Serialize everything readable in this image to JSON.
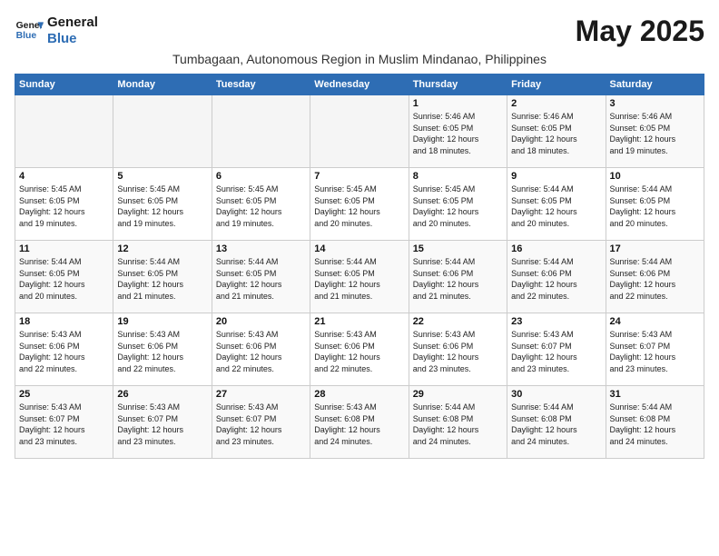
{
  "logo": {
    "line1": "General",
    "line2": "Blue"
  },
  "title": "May 2025",
  "subtitle": "Tumbagaan, Autonomous Region in Muslim Mindanao, Philippines",
  "headers": [
    "Sunday",
    "Monday",
    "Tuesday",
    "Wednesday",
    "Thursday",
    "Friday",
    "Saturday"
  ],
  "weeks": [
    [
      {
        "day": "",
        "info": ""
      },
      {
        "day": "",
        "info": ""
      },
      {
        "day": "",
        "info": ""
      },
      {
        "day": "",
        "info": ""
      },
      {
        "day": "1",
        "info": "Sunrise: 5:46 AM\nSunset: 6:05 PM\nDaylight: 12 hours\nand 18 minutes."
      },
      {
        "day": "2",
        "info": "Sunrise: 5:46 AM\nSunset: 6:05 PM\nDaylight: 12 hours\nand 18 minutes."
      },
      {
        "day": "3",
        "info": "Sunrise: 5:46 AM\nSunset: 6:05 PM\nDaylight: 12 hours\nand 19 minutes."
      }
    ],
    [
      {
        "day": "4",
        "info": "Sunrise: 5:45 AM\nSunset: 6:05 PM\nDaylight: 12 hours\nand 19 minutes."
      },
      {
        "day": "5",
        "info": "Sunrise: 5:45 AM\nSunset: 6:05 PM\nDaylight: 12 hours\nand 19 minutes."
      },
      {
        "day": "6",
        "info": "Sunrise: 5:45 AM\nSunset: 6:05 PM\nDaylight: 12 hours\nand 19 minutes."
      },
      {
        "day": "7",
        "info": "Sunrise: 5:45 AM\nSunset: 6:05 PM\nDaylight: 12 hours\nand 20 minutes."
      },
      {
        "day": "8",
        "info": "Sunrise: 5:45 AM\nSunset: 6:05 PM\nDaylight: 12 hours\nand 20 minutes."
      },
      {
        "day": "9",
        "info": "Sunrise: 5:44 AM\nSunset: 6:05 PM\nDaylight: 12 hours\nand 20 minutes."
      },
      {
        "day": "10",
        "info": "Sunrise: 5:44 AM\nSunset: 6:05 PM\nDaylight: 12 hours\nand 20 minutes."
      }
    ],
    [
      {
        "day": "11",
        "info": "Sunrise: 5:44 AM\nSunset: 6:05 PM\nDaylight: 12 hours\nand 20 minutes."
      },
      {
        "day": "12",
        "info": "Sunrise: 5:44 AM\nSunset: 6:05 PM\nDaylight: 12 hours\nand 21 minutes."
      },
      {
        "day": "13",
        "info": "Sunrise: 5:44 AM\nSunset: 6:05 PM\nDaylight: 12 hours\nand 21 minutes."
      },
      {
        "day": "14",
        "info": "Sunrise: 5:44 AM\nSunset: 6:05 PM\nDaylight: 12 hours\nand 21 minutes."
      },
      {
        "day": "15",
        "info": "Sunrise: 5:44 AM\nSunset: 6:06 PM\nDaylight: 12 hours\nand 21 minutes."
      },
      {
        "day": "16",
        "info": "Sunrise: 5:44 AM\nSunset: 6:06 PM\nDaylight: 12 hours\nand 22 minutes."
      },
      {
        "day": "17",
        "info": "Sunrise: 5:44 AM\nSunset: 6:06 PM\nDaylight: 12 hours\nand 22 minutes."
      }
    ],
    [
      {
        "day": "18",
        "info": "Sunrise: 5:43 AM\nSunset: 6:06 PM\nDaylight: 12 hours\nand 22 minutes."
      },
      {
        "day": "19",
        "info": "Sunrise: 5:43 AM\nSunset: 6:06 PM\nDaylight: 12 hours\nand 22 minutes."
      },
      {
        "day": "20",
        "info": "Sunrise: 5:43 AM\nSunset: 6:06 PM\nDaylight: 12 hours\nand 22 minutes."
      },
      {
        "day": "21",
        "info": "Sunrise: 5:43 AM\nSunset: 6:06 PM\nDaylight: 12 hours\nand 22 minutes."
      },
      {
        "day": "22",
        "info": "Sunrise: 5:43 AM\nSunset: 6:06 PM\nDaylight: 12 hours\nand 23 minutes."
      },
      {
        "day": "23",
        "info": "Sunrise: 5:43 AM\nSunset: 6:07 PM\nDaylight: 12 hours\nand 23 minutes."
      },
      {
        "day": "24",
        "info": "Sunrise: 5:43 AM\nSunset: 6:07 PM\nDaylight: 12 hours\nand 23 minutes."
      }
    ],
    [
      {
        "day": "25",
        "info": "Sunrise: 5:43 AM\nSunset: 6:07 PM\nDaylight: 12 hours\nand 23 minutes."
      },
      {
        "day": "26",
        "info": "Sunrise: 5:43 AM\nSunset: 6:07 PM\nDaylight: 12 hours\nand 23 minutes."
      },
      {
        "day": "27",
        "info": "Sunrise: 5:43 AM\nSunset: 6:07 PM\nDaylight: 12 hours\nand 23 minutes."
      },
      {
        "day": "28",
        "info": "Sunrise: 5:43 AM\nSunset: 6:08 PM\nDaylight: 12 hours\nand 24 minutes."
      },
      {
        "day": "29",
        "info": "Sunrise: 5:44 AM\nSunset: 6:08 PM\nDaylight: 12 hours\nand 24 minutes."
      },
      {
        "day": "30",
        "info": "Sunrise: 5:44 AM\nSunset: 6:08 PM\nDaylight: 12 hours\nand 24 minutes."
      },
      {
        "day": "31",
        "info": "Sunrise: 5:44 AM\nSunset: 6:08 PM\nDaylight: 12 hours\nand 24 minutes."
      }
    ]
  ]
}
